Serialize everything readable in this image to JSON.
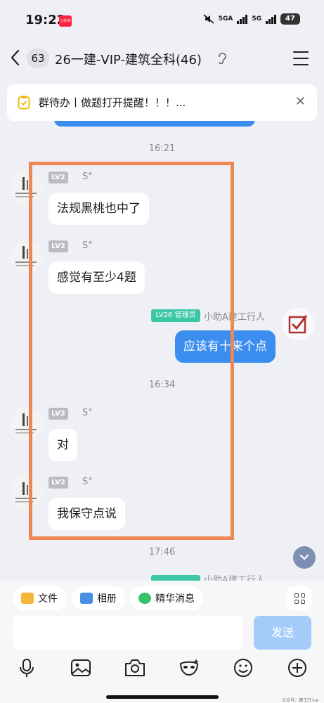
{
  "status_bar": {
    "time": "19:22",
    "notif_app": "小红书",
    "net1": "5GA",
    "net2": "5G",
    "battery": "47"
  },
  "header": {
    "back_icon": "chevron-left-icon",
    "unread_count": "63",
    "title": "26一建-VIP-建筑全科(46)"
  },
  "pinned": {
    "text": "群待办丨做题打开提醒！！！..."
  },
  "messages": [
    {
      "time": "16:21"
    },
    {
      "level": "LV2",
      "sender": "S°",
      "text": "法规黑桃也中了"
    },
    {
      "level": "LV2",
      "sender": "S°",
      "text": "感觉有至少4题"
    },
    {
      "level": "LV26",
      "role": "管理员",
      "sender": "小助A建工行人",
      "text": "应该有十来个点"
    },
    {
      "time": "16:34"
    },
    {
      "level": "LV2",
      "sender": "S°",
      "text": "对"
    },
    {
      "level": "LV2",
      "sender": "S°",
      "text": "我保守点说"
    },
    {
      "time": "17:46"
    }
  ],
  "partial_next": {
    "sender": "小助A建工行人"
  },
  "quick_actions": [
    {
      "label": "文件",
      "icon": "folder-icon"
    },
    {
      "label": "相册",
      "icon": "image-icon"
    },
    {
      "label": "精华消息",
      "icon": "star-badge-icon"
    }
  ],
  "composer": {
    "send_label": "发送"
  },
  "toolbar_icons": [
    "microphone-icon",
    "picture-icon",
    "camera-icon",
    "mask-icon",
    "emoji-icon",
    "plus-icon"
  ],
  "watermark": "公众号：建工行人e",
  "colors": {
    "bubble_mine": "#3b8ef0",
    "admin_badge": "#3bc6a6",
    "highlight_box": "#ee8754",
    "send_disabled": "#a4cbf9"
  }
}
